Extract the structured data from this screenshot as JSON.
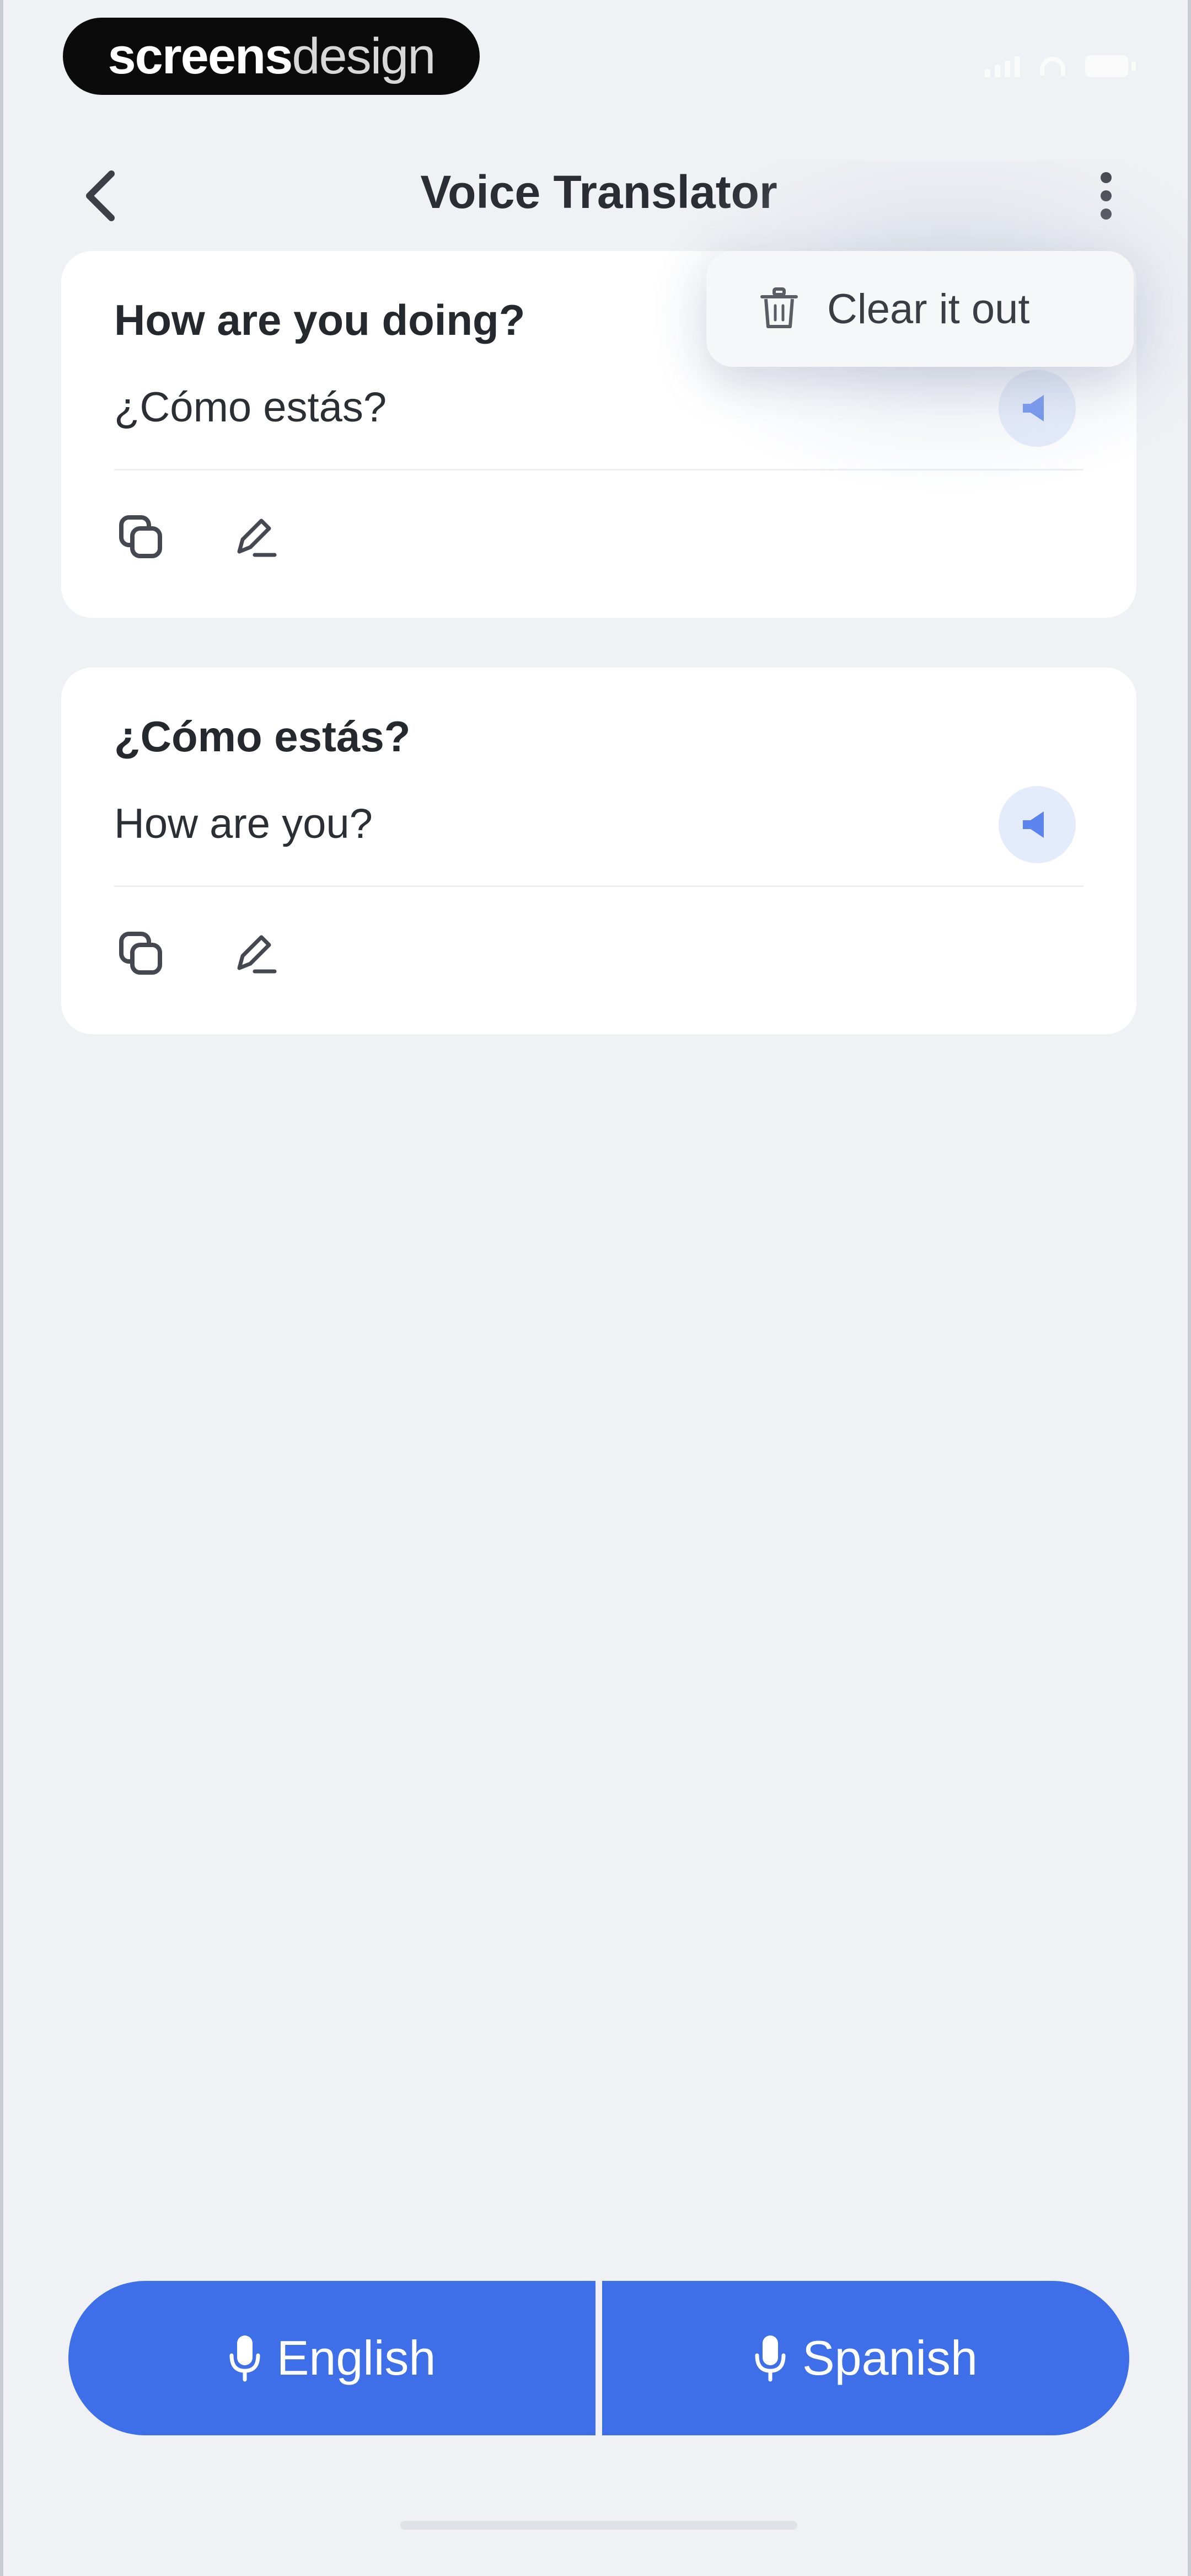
{
  "status_bar": {
    "brand_bold": "screens",
    "brand_light": "design"
  },
  "header": {
    "title": "Voice Translator",
    "back_icon": "chevron-left-icon",
    "more_icon": "vertical-dots-icon"
  },
  "menu": {
    "items": [
      {
        "label": "Clear it out",
        "icon": "trash-icon"
      }
    ]
  },
  "translations": [
    {
      "source": "How are you doing?",
      "translated": "¿Cómo estás?",
      "actions": [
        "copy-icon",
        "edit-icon"
      ]
    },
    {
      "source": "¿Cómo estás?",
      "translated": "How are you?",
      "actions": [
        "copy-icon",
        "edit-icon"
      ]
    }
  ],
  "languages": {
    "left": "English",
    "right": "Spanish"
  },
  "colors": {
    "accent": "#3e6fe8",
    "speak_bg": "#e4ebfb",
    "background": "#eff1f4",
    "card": "#ffffff"
  }
}
